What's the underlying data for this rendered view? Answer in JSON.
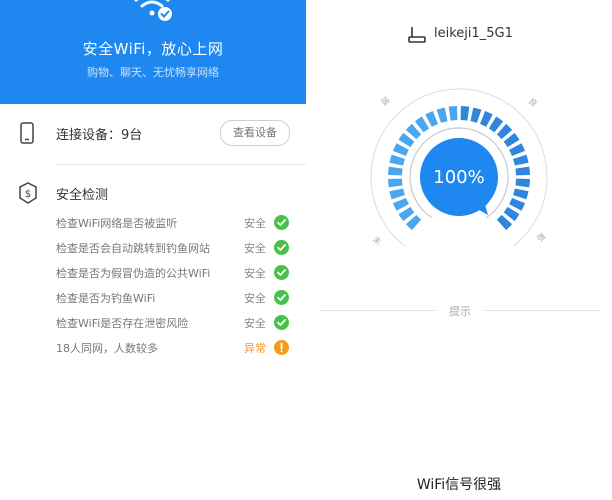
{
  "left": {
    "hero_title": "安全WiFi，放心上网",
    "hero_subtitle": "购物、聊天、无忧畅享网络",
    "connected_label": "连接设备：9台",
    "view_devices_button": "查看设备",
    "security_title": "安全检测",
    "checks": [
      {
        "text": "检查WiFi网络是否被监听",
        "status": "安全",
        "state": "ok"
      },
      {
        "text": "检查是否会自动跳转到钓鱼网站",
        "status": "安全",
        "state": "ok"
      },
      {
        "text": "检查是否为假冒伪造的公共WiFi",
        "status": "安全",
        "state": "ok"
      },
      {
        "text": "检查是否为钓鱼WiFi",
        "status": "安全",
        "state": "ok"
      },
      {
        "text": "检查WiFi是否存在泄密风险",
        "status": "安全",
        "state": "ok"
      },
      {
        "text": "18人同网，人数较多",
        "status": "异常",
        "state": "warn"
      }
    ]
  },
  "right": {
    "ssid": "leikeji1_5G1",
    "signal_percent_text": "100%",
    "signal_fraction": 1.0,
    "gauge_labels": {
      "top_left": "弱",
      "top_right": "良",
      "bottom_left": "未",
      "bottom_right": "强"
    },
    "hint": "提示",
    "strength_text": "WiFi信号很强"
  },
  "colors": {
    "brand_blue": "#1e88f0",
    "ok_green": "#47c14a",
    "warn_orange": "#f39b1c"
  }
}
